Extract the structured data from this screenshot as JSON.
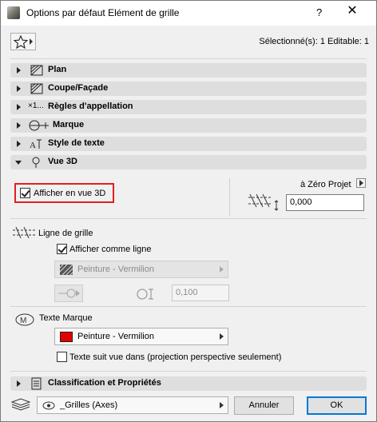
{
  "window": {
    "title": "Options par défaut Elément de grille",
    "help": "?",
    "close": "✕"
  },
  "header": {
    "selection_info": "Sélectionné(s): 1 Editable: 1"
  },
  "panels": {
    "plan": "Plan",
    "coupe": "Coupe/Façade",
    "regles": "Règles d'appellation",
    "regles_prefix": "×1...",
    "marque": "Marque",
    "style": "Style de texte",
    "vue3d": "Vue 3D",
    "classification": "Classification et Propriétés"
  },
  "vue3d": {
    "show_3d_label": "Afficher en vue 3D",
    "show_3d_checked": true,
    "zero_label": "à Zéro Projet",
    "elevation_value": "0,000"
  },
  "ligne_de_grille": {
    "section_label": "Ligne de grille",
    "show_as_line_label": "Afficher comme ligne",
    "show_as_line_checked": true,
    "pen_label": "Peinture - Vermilion",
    "thickness_value": "0,100"
  },
  "texte_marque": {
    "section_label": "Texte Marque",
    "pen_label": "Peinture - Vermilion",
    "pen_color": "#e50000",
    "follow_view_label": "Texte suit vue dans (projection perspective seulement)",
    "follow_view_checked": false
  },
  "footer": {
    "layer_label": "_Grilles (Axes)",
    "cancel_label": "Annuler",
    "ok_label": "OK"
  },
  "colors": {
    "highlight": "#e21e1e",
    "accent": "#0078d7"
  }
}
